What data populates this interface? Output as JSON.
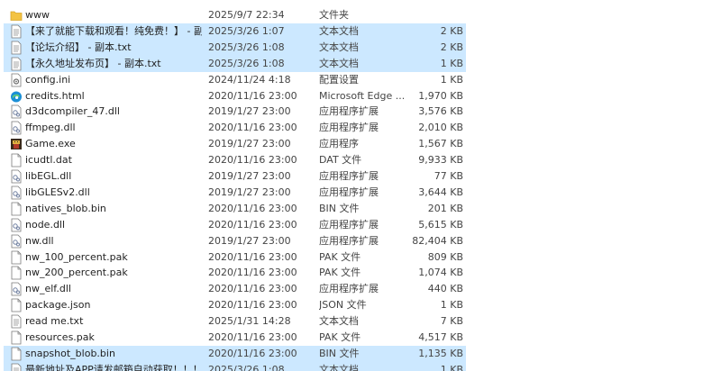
{
  "files": [
    {
      "name": "www",
      "date": "2025/9/7 22:34",
      "type": "文件夹",
      "size": "",
      "icon": "folder-icon",
      "selected": false
    },
    {
      "name": "【来了就能下载和观看！纯免费！】 - 副...",
      "date": "2025/3/26 1:07",
      "type": "文本文档",
      "size": "2 KB",
      "icon": "text-file-icon",
      "selected": true
    },
    {
      "name": "【论坛介绍】 - 副本.txt",
      "date": "2025/3/26 1:08",
      "type": "文本文档",
      "size": "2 KB",
      "icon": "text-file-icon",
      "selected": true
    },
    {
      "name": "【永久地址发布页】 - 副本.txt",
      "date": "2025/3/26 1:08",
      "type": "文本文档",
      "size": "1 KB",
      "icon": "text-file-icon",
      "selected": true
    },
    {
      "name": "config.ini",
      "date": "2024/11/24 4:18",
      "type": "配置设置",
      "size": "1 KB",
      "icon": "settings-file-icon",
      "selected": false
    },
    {
      "name": "credits.html",
      "date": "2020/11/16 23:00",
      "type": "Microsoft Edge ...",
      "size": "1,970 KB",
      "icon": "edge-icon",
      "selected": false
    },
    {
      "name": "d3dcompiler_47.dll",
      "date": "2019/1/27 23:00",
      "type": "应用程序扩展",
      "size": "3,576 KB",
      "icon": "dll-file-icon",
      "selected": false
    },
    {
      "name": "ffmpeg.dll",
      "date": "2020/11/16 23:00",
      "type": "应用程序扩展",
      "size": "2,010 KB",
      "icon": "dll-file-icon",
      "selected": false
    },
    {
      "name": "Game.exe",
      "date": "2019/1/27 23:00",
      "type": "应用程序",
      "size": "1,567 KB",
      "icon": "game-exe-icon",
      "selected": false
    },
    {
      "name": "icudtl.dat",
      "date": "2020/11/16 23:00",
      "type": "DAT 文件",
      "size": "9,933 KB",
      "icon": "blank-file-icon",
      "selected": false
    },
    {
      "name": "libEGL.dll",
      "date": "2019/1/27 23:00",
      "type": "应用程序扩展",
      "size": "77 KB",
      "icon": "dll-file-icon",
      "selected": false
    },
    {
      "name": "libGLESv2.dll",
      "date": "2019/1/27 23:00",
      "type": "应用程序扩展",
      "size": "3,644 KB",
      "icon": "dll-file-icon",
      "selected": false
    },
    {
      "name": "natives_blob.bin",
      "date": "2020/11/16 23:00",
      "type": "BIN 文件",
      "size": "201 KB",
      "icon": "blank-file-icon",
      "selected": false
    },
    {
      "name": "node.dll",
      "date": "2020/11/16 23:00",
      "type": "应用程序扩展",
      "size": "5,615 KB",
      "icon": "dll-file-icon",
      "selected": false
    },
    {
      "name": "nw.dll",
      "date": "2019/1/27 23:00",
      "type": "应用程序扩展",
      "size": "82,404 KB",
      "icon": "dll-file-icon",
      "selected": false
    },
    {
      "name": "nw_100_percent.pak",
      "date": "2020/11/16 23:00",
      "type": "PAK 文件",
      "size": "809 KB",
      "icon": "blank-file-icon",
      "selected": false
    },
    {
      "name": "nw_200_percent.pak",
      "date": "2020/11/16 23:00",
      "type": "PAK 文件",
      "size": "1,074 KB",
      "icon": "blank-file-icon",
      "selected": false
    },
    {
      "name": "nw_elf.dll",
      "date": "2020/11/16 23:00",
      "type": "应用程序扩展",
      "size": "440 KB",
      "icon": "dll-file-icon",
      "selected": false
    },
    {
      "name": "package.json",
      "date": "2020/11/16 23:00",
      "type": "JSON 文件",
      "size": "1 KB",
      "icon": "blank-file-icon",
      "selected": false
    },
    {
      "name": "read me.txt",
      "date": "2025/1/31 14:28",
      "type": "文本文档",
      "size": "7 KB",
      "icon": "text-file-icon",
      "selected": false
    },
    {
      "name": "resources.pak",
      "date": "2020/11/16 23:00",
      "type": "PAK 文件",
      "size": "4,517 KB",
      "icon": "blank-file-icon",
      "selected": false
    },
    {
      "name": "snapshot_blob.bin",
      "date": "2020/11/16 23:00",
      "type": "BIN 文件",
      "size": "1,135 KB",
      "icon": "blank-file-icon",
      "selected": true
    },
    {
      "name": "最新地址及APP请发邮箱自动获取！！！",
      "date": "2025/3/26 1:08",
      "type": "文本文档",
      "size": "1 KB",
      "icon": "text-file-icon",
      "selected": true
    }
  ],
  "colors": {
    "selection": "#cce8ff",
    "folder": "#f3c343",
    "edge": "#1b8fd6"
  }
}
